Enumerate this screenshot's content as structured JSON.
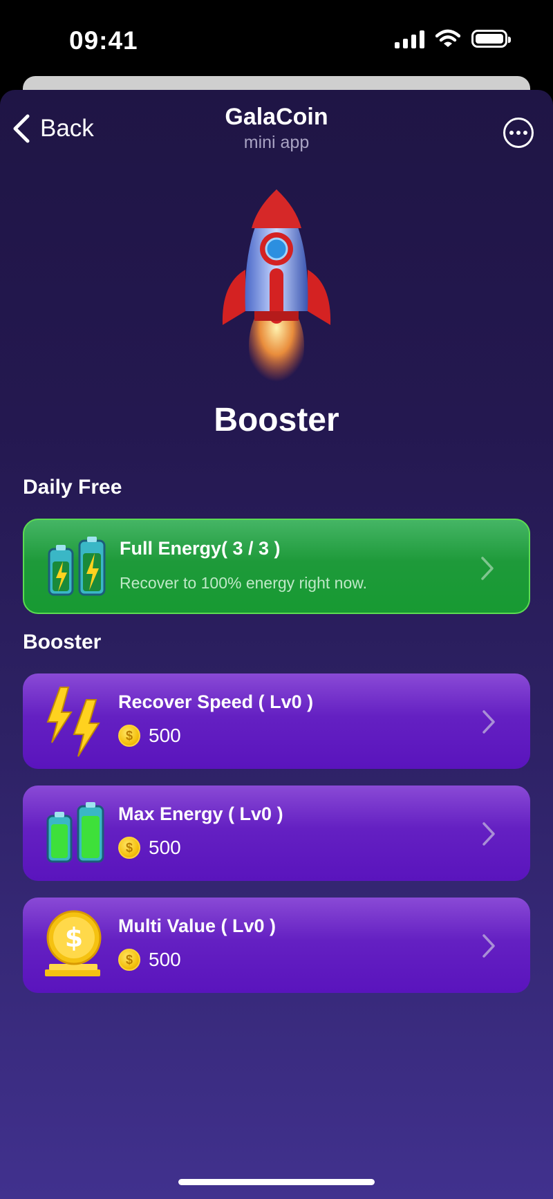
{
  "status_bar": {
    "time": "09:41"
  },
  "nav": {
    "back_label": "Back",
    "title": "GalaCoin",
    "subtitle": "mini app"
  },
  "hero": {
    "title": "Booster",
    "icon": "rocket-icon"
  },
  "daily_free": {
    "section_title": "Daily Free",
    "items": [
      {
        "title": "Full Energy( 3 / 3 )",
        "description": "Recover to 100% energy right now.",
        "icon": "batteries-icon"
      }
    ]
  },
  "booster": {
    "section_title": "Booster",
    "items": [
      {
        "title": "Recover Speed ( Lv0 )",
        "price": "500",
        "icon": "lightning-icon"
      },
      {
        "title": "Max Energy ( Lv0 )",
        "price": "500",
        "icon": "green-batteries-icon"
      },
      {
        "title": "Multi Value ( Lv0 )",
        "price": "500",
        "icon": "gold-coin-icon"
      }
    ]
  },
  "coin_symbol": "$",
  "colors": {
    "accent_green": "#1e9a3a",
    "accent_purple": "#6420c2",
    "background": "#241850"
  }
}
